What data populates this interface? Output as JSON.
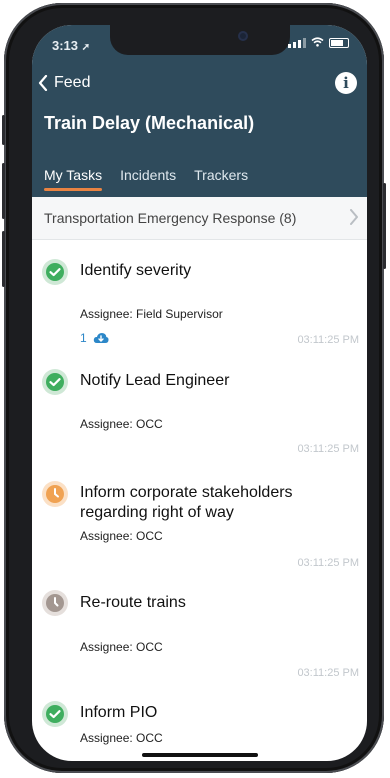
{
  "status_bar": {
    "time": "3:13"
  },
  "nav": {
    "back_label": "Feed"
  },
  "header": {
    "title": "Train Delay (Mechanical)"
  },
  "tabs": [
    {
      "label": "My Tasks",
      "active": true
    },
    {
      "label": "Incidents",
      "active": false
    },
    {
      "label": "Trackers",
      "active": false
    }
  ],
  "section": {
    "title": "Transportation Emergency Response (8)"
  },
  "tasks": [
    {
      "title": "Identify severity",
      "assignee": "Assignee: Field Supervisor",
      "attachments": "1",
      "time": "03:11:25 PM",
      "status_icon": "check-icon",
      "status_color": "#3fae5f"
    },
    {
      "title": "Notify Lead Engineer",
      "assignee": "Assignee: OCC",
      "time": "03:11:25 PM",
      "status_icon": "check-icon",
      "status_color": "#3fae5f"
    },
    {
      "title": "Inform corporate stakeholders regarding right of way",
      "assignee": "Assignee: OCC",
      "time": "03:11:25 PM",
      "status_icon": "clock-icon",
      "status_color": "#f0a252"
    },
    {
      "title": "Re-route trains",
      "assignee": "Assignee: OCC",
      "time": "03:11:25 PM",
      "status_icon": "clock-icon",
      "status_color": "#a39791"
    },
    {
      "title": "Inform PIO",
      "assignee": "Assignee: OCC",
      "status_icon": "check-icon",
      "status_color": "#3fae5f"
    }
  ],
  "colors": {
    "header_bg": "#2f4b5c",
    "accent": "#e98342",
    "link": "#2c87c8"
  }
}
